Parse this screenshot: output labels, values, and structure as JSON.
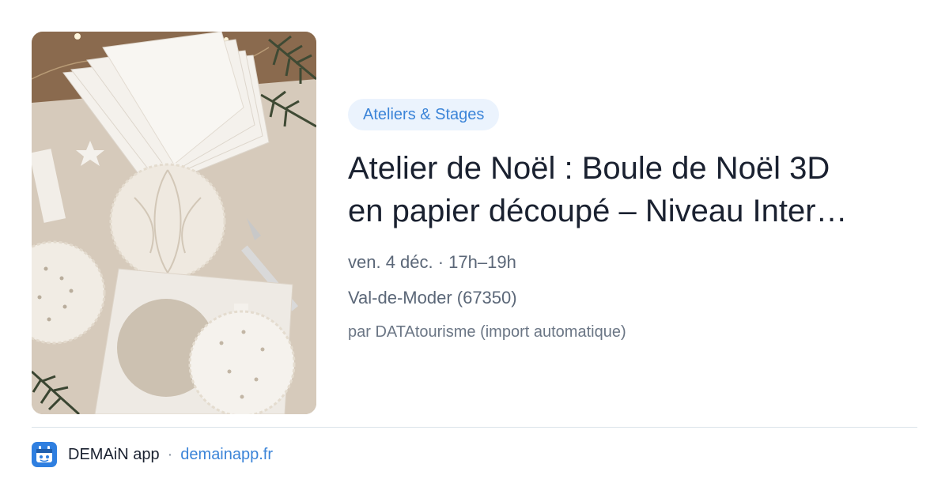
{
  "event": {
    "category": "Ateliers & Stages",
    "title_line1": "Atelier de Noël : Boule de Noël 3D",
    "title_line2": "en papier découpé – Niveau Inter…",
    "datetime": "ven. 4 déc. · 17h–19h",
    "location": "Val-de-Moder (67350)",
    "source": "par DATAtourisme (import automatique)",
    "image_subject": "paper-cut christmas ornaments"
  },
  "footer": {
    "app_name": "DEMAiN app",
    "separator": "·",
    "domain": "demainapp.fr"
  },
  "colors": {
    "accent": "#3b84d8",
    "category_bg": "#ebf3fd",
    "title": "#1a2130",
    "meta": "#5b6778",
    "divider": "#dbe3ea"
  }
}
